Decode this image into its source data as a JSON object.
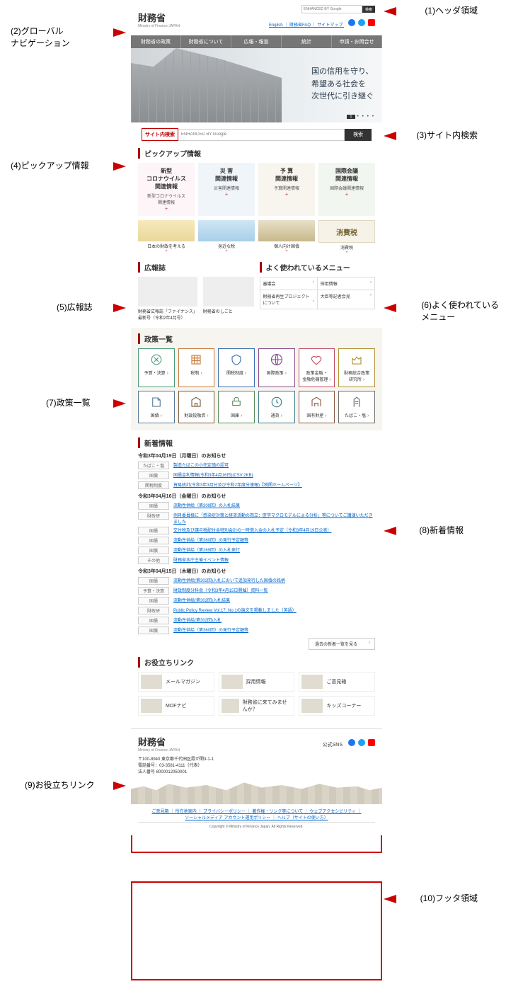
{
  "annotations": {
    "a1": "(1)ヘッダ領域",
    "a2": "(2)グローバル\nナビゲーション",
    "a3": "(3)サイト内検索",
    "a4": "(4)ピックアップ情報",
    "a5": "(5)広報誌",
    "a6": "(6)よく使われている\nメニュー",
    "a7": "(7)政策一覧",
    "a8": "(8)新着情報",
    "a9": "(9)お役立ちリンク",
    "a10": "(10)フッタ領域"
  },
  "header": {
    "logo": "財務省",
    "logo_sub": "Ministry of Finance JAPAN",
    "links": "English ｜ 財務省FAQ ｜ サイトマップ",
    "search_placeholder": "ENHANCED BY Google",
    "search_btn": "検索"
  },
  "gnav": [
    "財務省の政策",
    "財務省について",
    "広報・報道",
    "統計",
    "申請・お問合せ"
  ],
  "hero": {
    "l1": "国の信用を守り、",
    "l2": "希望ある社会を",
    "l3": "次世代に引き継ぐ",
    "page": "1"
  },
  "sitesearch": {
    "label": "サイト内検索",
    "placeholder": "ENHANCED BY Google",
    "btn": "検索"
  },
  "pickup": {
    "heading": "ピックアップ情報",
    "cards": [
      {
        "t": "新型\nコロナウイルス\n関連情報",
        "s": "新型コロナウイルス\n関連情報"
      },
      {
        "t": "災 害\n関連情報",
        "s": "災害関連情報"
      },
      {
        "t": "予 算\n関連情報",
        "s": "予算関連情報"
      },
      {
        "t": "国際会議\n関連情報",
        "s": "国際会議関連情報"
      }
    ],
    "cards2": [
      {
        "t": "日本の財政を考える",
        "s": "日本の財政を考える"
      },
      {
        "t": "身近な税",
        "s": "身近な税"
      },
      {
        "t": "個人向け国債",
        "s": "個人向け国債"
      },
      {
        "t": "消費税",
        "s": "消費税"
      }
    ]
  },
  "magazines": {
    "heading": "広報誌",
    "items": [
      {
        "t": "財務省広報誌「ファイナンス」\n最新号（令和2年4月号）"
      },
      {
        "t": "財務省のしごと"
      }
    ]
  },
  "freq": {
    "heading": "よく使われているメニュー",
    "items": [
      "審議会",
      "採用情報",
      "財務省再生プロジェクト\nについて",
      "大臣等記者会見"
    ]
  },
  "policy": {
    "heading": "政策一覧",
    "items": [
      "予算・決算",
      "税制",
      "関税制度",
      "国際政策",
      "政策金融・\n金融危機管理",
      "財務総合政策\n研究所",
      "国債",
      "財政投融資",
      "国庫",
      "通貨",
      "国有財産",
      "たばこ・塩"
    ]
  },
  "news": {
    "heading": "新着情報",
    "groups": [
      {
        "date": "令和3年04月19日（月曜日）のお知らせ",
        "items": [
          {
            "tag": "たばこ・塩",
            "txt": "製造たばこの小売定価の認可"
          },
          {
            "tag": "国債",
            "txt": "国債金利情報(令和3年4月16日)(CSV:2KB)"
          },
          {
            "tag": "関税制度",
            "txt": "貿易統計(令和3年3月分及び令和2年度分速報)【税関ホームページ】"
          }
        ]
      },
      {
        "date": "令和3年04月16日（金曜日）のお知らせ",
        "items": [
          {
            "tag": "国債",
            "txt": "流動性供給（第309回）の入札結果"
          },
          {
            "tag": "財政研",
            "txt": "例月委員様に「感染症対策と経済活動の両立：医学マクロモデルによる分析」等についてご講演いただきました"
          },
          {
            "tag": "国債",
            "txt": "交付税及び譲与税配付金特別会計の一時借入金の入札予定（令和3年4月19日公表）"
          },
          {
            "tag": "国債",
            "txt": "流動性供給（第360回）の発行予定額等"
          },
          {
            "tag": "国債",
            "txt": "流動性供給（第269回）の入札発行"
          },
          {
            "tag": "その他",
            "txt": "財務省本庁主催イベント情報"
          }
        ]
      },
      {
        "date": "令和3年04月15日（木曜日）のお知らせ",
        "items": [
          {
            "tag": "国債",
            "txt": "流動性供給(第302回)入札において追加発行した国債の銘柄"
          },
          {
            "tag": "予算・決算",
            "txt": "財政制度分科会（令和3年4月15日開催）資料一覧"
          },
          {
            "tag": "国債",
            "txt": "流動性供給(第302回)入札結果"
          },
          {
            "tag": "財政研",
            "txt": "Public Policy Review Vol.17, No.1の論文を掲載しました（英語）"
          },
          {
            "tag": "国債",
            "txt": "流動性供給(第302回)入札"
          },
          {
            "tag": "国債",
            "txt": "流動性供給（第360回）の発行予定額等"
          }
        ]
      }
    ],
    "more": "過去の新着一覧を見る"
  },
  "useful": {
    "heading": "お役立ちリンク",
    "items": [
      "メールマガジン",
      "採用情報",
      "ご意見箱",
      "MOFナビ",
      "財務省に来てみませんか？",
      "キッズコーナー"
    ]
  },
  "footer": {
    "logo": "財務省",
    "logo_sub": "Ministry of Finance JAPAN",
    "sns_label": "公式SNS",
    "addr": "〒100-8940 東京都千代田区霞が関3-1-1\n電話番号：03-3581-4111（代表）\n法人番号 8000012050001",
    "links": "ご意見箱 ｜ 所在地案内 ｜ プライバシーポリシー ｜ 著作権・リンク等について ｜ ウェブアクセシビリティ ｜\nソーシャルメディア アカウント運用ポリシー ｜ ヘルプ（サイトの使い方）",
    "copy": "Copyright © Ministry of Finance Japan. All Rights Reserved."
  }
}
